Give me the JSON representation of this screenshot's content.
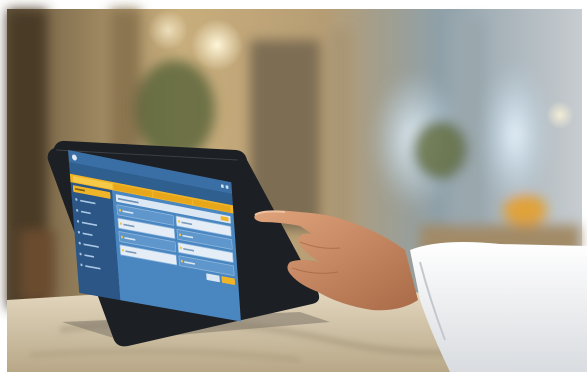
{
  "scene": {
    "description_colors": {
      "wall": "#cdb48a",
      "counter": "#d8c9ac",
      "tablet_frame": "#1e2125",
      "screen": "#2f5f8f",
      "accent_yellow": "#f0b429",
      "shirt": "#f2f3f5",
      "skin": "#c98a64"
    }
  },
  "tablet_ui": {
    "icons": [
      "app-logo-icon",
      "menu-icon",
      "settings-icon"
    ]
  }
}
